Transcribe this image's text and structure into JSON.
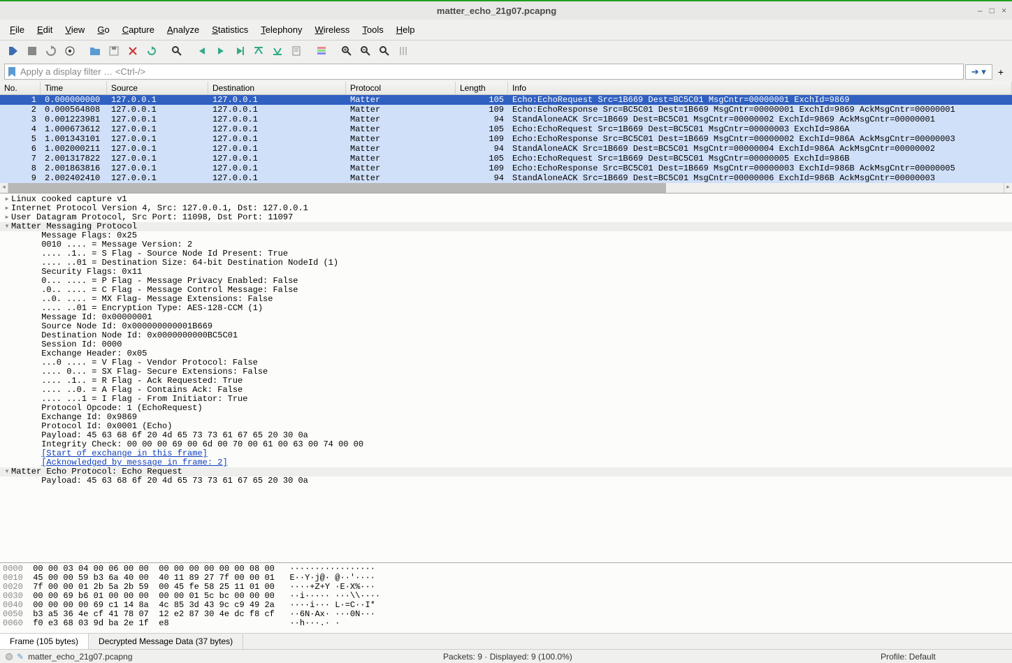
{
  "window": {
    "title": "matter_echo_21g07.pcapng"
  },
  "menu": [
    "File",
    "Edit",
    "View",
    "Go",
    "Capture",
    "Analyze",
    "Statistics",
    "Telephony",
    "Wireless",
    "Tools",
    "Help"
  ],
  "menu_accel": [
    "F",
    "E",
    "V",
    "G",
    "C",
    "A",
    "S",
    "T",
    "W",
    "T",
    "H"
  ],
  "filter": {
    "placeholder": "Apply a display filter … <Ctrl-/>",
    "value": ""
  },
  "packet_columns": [
    "No.",
    "Time",
    "Source",
    "Destination",
    "Protocol",
    "Length",
    "Info"
  ],
  "packets": [
    {
      "no": 1,
      "time": "0.000000000",
      "src": "127.0.0.1",
      "dst": "127.0.0.1",
      "proto": "Matter",
      "len": 105,
      "info": "Echo:EchoRequest Src=1B669 Dest=BC5C01 MsgCntr=00000001 ExchId=9869",
      "selected": true
    },
    {
      "no": 2,
      "time": "0.000564808",
      "src": "127.0.0.1",
      "dst": "127.0.0.1",
      "proto": "Matter",
      "len": 109,
      "info": "Echo:EchoResponse Src=BC5C01 Dest=1B669 MsgCntr=00000001 ExchId=9869 AckMsgCntr=00000001",
      "related": true
    },
    {
      "no": 3,
      "time": "0.001223981",
      "src": "127.0.0.1",
      "dst": "127.0.0.1",
      "proto": "Matter",
      "len": 94,
      "info": "StandAloneACK Src=1B669 Dest=BC5C01 MsgCntr=00000002 ExchId=9869 AckMsgCntr=00000001",
      "related": true
    },
    {
      "no": 4,
      "time": "1.000673612",
      "src": "127.0.0.1",
      "dst": "127.0.0.1",
      "proto": "Matter",
      "len": 105,
      "info": "Echo:EchoRequest Src=1B669 Dest=BC5C01 MsgCntr=00000003 ExchId=986A",
      "related": true
    },
    {
      "no": 5,
      "time": "1.001343101",
      "src": "127.0.0.1",
      "dst": "127.0.0.1",
      "proto": "Matter",
      "len": 109,
      "info": "Echo:EchoResponse Src=BC5C01 Dest=1B669 MsgCntr=00000002 ExchId=986A AckMsgCntr=00000003",
      "related": true
    },
    {
      "no": 6,
      "time": "1.002000211",
      "src": "127.0.0.1",
      "dst": "127.0.0.1",
      "proto": "Matter",
      "len": 94,
      "info": "StandAloneACK Src=1B669 Dest=BC5C01 MsgCntr=00000004 ExchId=986A AckMsgCntr=00000002",
      "related": true
    },
    {
      "no": 7,
      "time": "2.001317822",
      "src": "127.0.0.1",
      "dst": "127.0.0.1",
      "proto": "Matter",
      "len": 105,
      "info": "Echo:EchoRequest Src=1B669 Dest=BC5C01 MsgCntr=00000005 ExchId=986B",
      "related": true
    },
    {
      "no": 8,
      "time": "2.001863816",
      "src": "127.0.0.1",
      "dst": "127.0.0.1",
      "proto": "Matter",
      "len": 109,
      "info": "Echo:EchoResponse Src=BC5C01 Dest=1B669 MsgCntr=00000003 ExchId=986B AckMsgCntr=00000005",
      "related": true
    },
    {
      "no": 9,
      "time": "2.002402410",
      "src": "127.0.0.1",
      "dst": "127.0.0.1",
      "proto": "Matter",
      "len": 94,
      "info": "StandAloneACK Src=1B669 Dest=BC5C01 MsgCntr=00000006 ExchId=986B AckMsgCntr=00000003",
      "related": true
    }
  ],
  "details": [
    {
      "t": "▸",
      "i": 0,
      "text": "Linux cooked capture v1"
    },
    {
      "t": "▸",
      "i": 0,
      "text": "Internet Protocol Version 4, Src: 127.0.0.1, Dst: 127.0.0.1"
    },
    {
      "t": "▸",
      "i": 0,
      "text": "User Datagram Protocol, Src Port: 11098, Dst Port: 11097"
    },
    {
      "t": "▾",
      "i": 0,
      "text": "Matter Messaging Protocol",
      "hdr": true
    },
    {
      "t": " ",
      "i": 2,
      "text": "Message Flags: 0x25"
    },
    {
      "t": " ",
      "i": 2,
      "text": "0010 .... = Message Version: 2"
    },
    {
      "t": " ",
      "i": 2,
      "text": ".... .1.. = S Flag - Source Node Id Present: True"
    },
    {
      "t": " ",
      "i": 2,
      "text": ".... ..01 = Destination Size: 64-bit Destination NodeId (1)"
    },
    {
      "t": " ",
      "i": 2,
      "text": "Security Flags: 0x11"
    },
    {
      "t": " ",
      "i": 2,
      "text": "0... .... = P Flag - Message Privacy Enabled: False"
    },
    {
      "t": " ",
      "i": 2,
      "text": ".0.. .... = C Flag - Message Control Message: False"
    },
    {
      "t": " ",
      "i": 2,
      "text": "..0. .... = MX Flag- Message Extensions: False"
    },
    {
      "t": " ",
      "i": 2,
      "text": ".... ..01 = Encryption Type: AES-128-CCM (1)"
    },
    {
      "t": " ",
      "i": 2,
      "text": "Message Id: 0x00000001"
    },
    {
      "t": " ",
      "i": 2,
      "text": "Source Node Id: 0x000000000001B669"
    },
    {
      "t": " ",
      "i": 2,
      "text": "Destination Node Id: 0x0000000000BC5C01"
    },
    {
      "t": " ",
      "i": 2,
      "text": "Session Id: 0000"
    },
    {
      "t": " ",
      "i": 2,
      "text": "Exchange Header: 0x05"
    },
    {
      "t": " ",
      "i": 2,
      "text": "...0 .... = V Flag - Vendor Protocol: False"
    },
    {
      "t": " ",
      "i": 2,
      "text": ".... 0... = SX Flag- Secure Extensions: False"
    },
    {
      "t": " ",
      "i": 2,
      "text": ".... .1.. = R Flag - Ack Requested: True"
    },
    {
      "t": " ",
      "i": 2,
      "text": ".... ..0. = A Flag - Contains Ack: False"
    },
    {
      "t": " ",
      "i": 2,
      "text": ".... ...1 = I Flag - From Initiator: True"
    },
    {
      "t": " ",
      "i": 2,
      "text": "Protocol Opcode: 1 (EchoRequest)"
    },
    {
      "t": " ",
      "i": 2,
      "text": "Exchange Id: 0x9869"
    },
    {
      "t": " ",
      "i": 2,
      "text": "Protocol Id: 0x0001 (Echo)"
    },
    {
      "t": " ",
      "i": 2,
      "text": "Payload: 45 63 68 6f 20 4d 65 73 73 61 67 65 20 30 0a"
    },
    {
      "t": " ",
      "i": 2,
      "text": "Integrity Check: 00 00 00 69 00 6d 00 70 00 61 00 63 00 74 00 00"
    },
    {
      "t": " ",
      "i": 2,
      "text": "[Start of exchange in this frame]",
      "link": true
    },
    {
      "t": " ",
      "i": 2,
      "text": "[Acknowledged by message in frame: 2]",
      "link": true
    },
    {
      "t": "▾",
      "i": 0,
      "text": "Matter Echo Protocol: Echo Request",
      "hdr": true
    },
    {
      "t": " ",
      "i": 2,
      "text": "Payload: 45 63 68 6f 20 4d 65 73 73 61 67 65 20 30 0a"
    }
  ],
  "hex": [
    {
      "off": "0000",
      "b": "00 00 03 04 00 06 00 00  00 00 00 00 00 00 08 00",
      "a": "·················"
    },
    {
      "off": "0010",
      "b": "45 00 00 59 b3 6a 40 00  40 11 89 27 7f 00 00 01",
      "a": "E··Y·j@· @··'····"
    },
    {
      "off": "0020",
      "b": "7f 00 00 01 2b 5a 2b 59  00 45 fe 58 25 11 01 00",
      "a": "····+Z+Y ·E·X%···"
    },
    {
      "off": "0030",
      "b": "00 00 69 b6 01 00 00 00  00 00 01 5c bc 00 00 00",
      "a": "··i····· ···\\\\····"
    },
    {
      "off": "0040",
      "b": "00 00 00 00 69 c1 14 8a  4c 85 3d 43 9c c9 49 2a",
      "a": "····i··· L·=C··I*"
    },
    {
      "off": "0050",
      "b": "b3 a5 36 4e cf 41 78 07  12 e2 87 30 4e dc f8 cf",
      "a": "··6N·Ax· ···0N···"
    },
    {
      "off": "0060",
      "b": "f0 e3 68 03 9d ba 2e 1f  e8",
      "a": "··h···.· ·"
    }
  ],
  "tabs": [
    "Frame (105 bytes)",
    "Decrypted Message Data (37 bytes)"
  ],
  "status": {
    "file": "matter_echo_21g07.pcapng",
    "packets": "Packets: 9 · Displayed: 9 (100.0%)",
    "profile": "Profile: Default"
  }
}
